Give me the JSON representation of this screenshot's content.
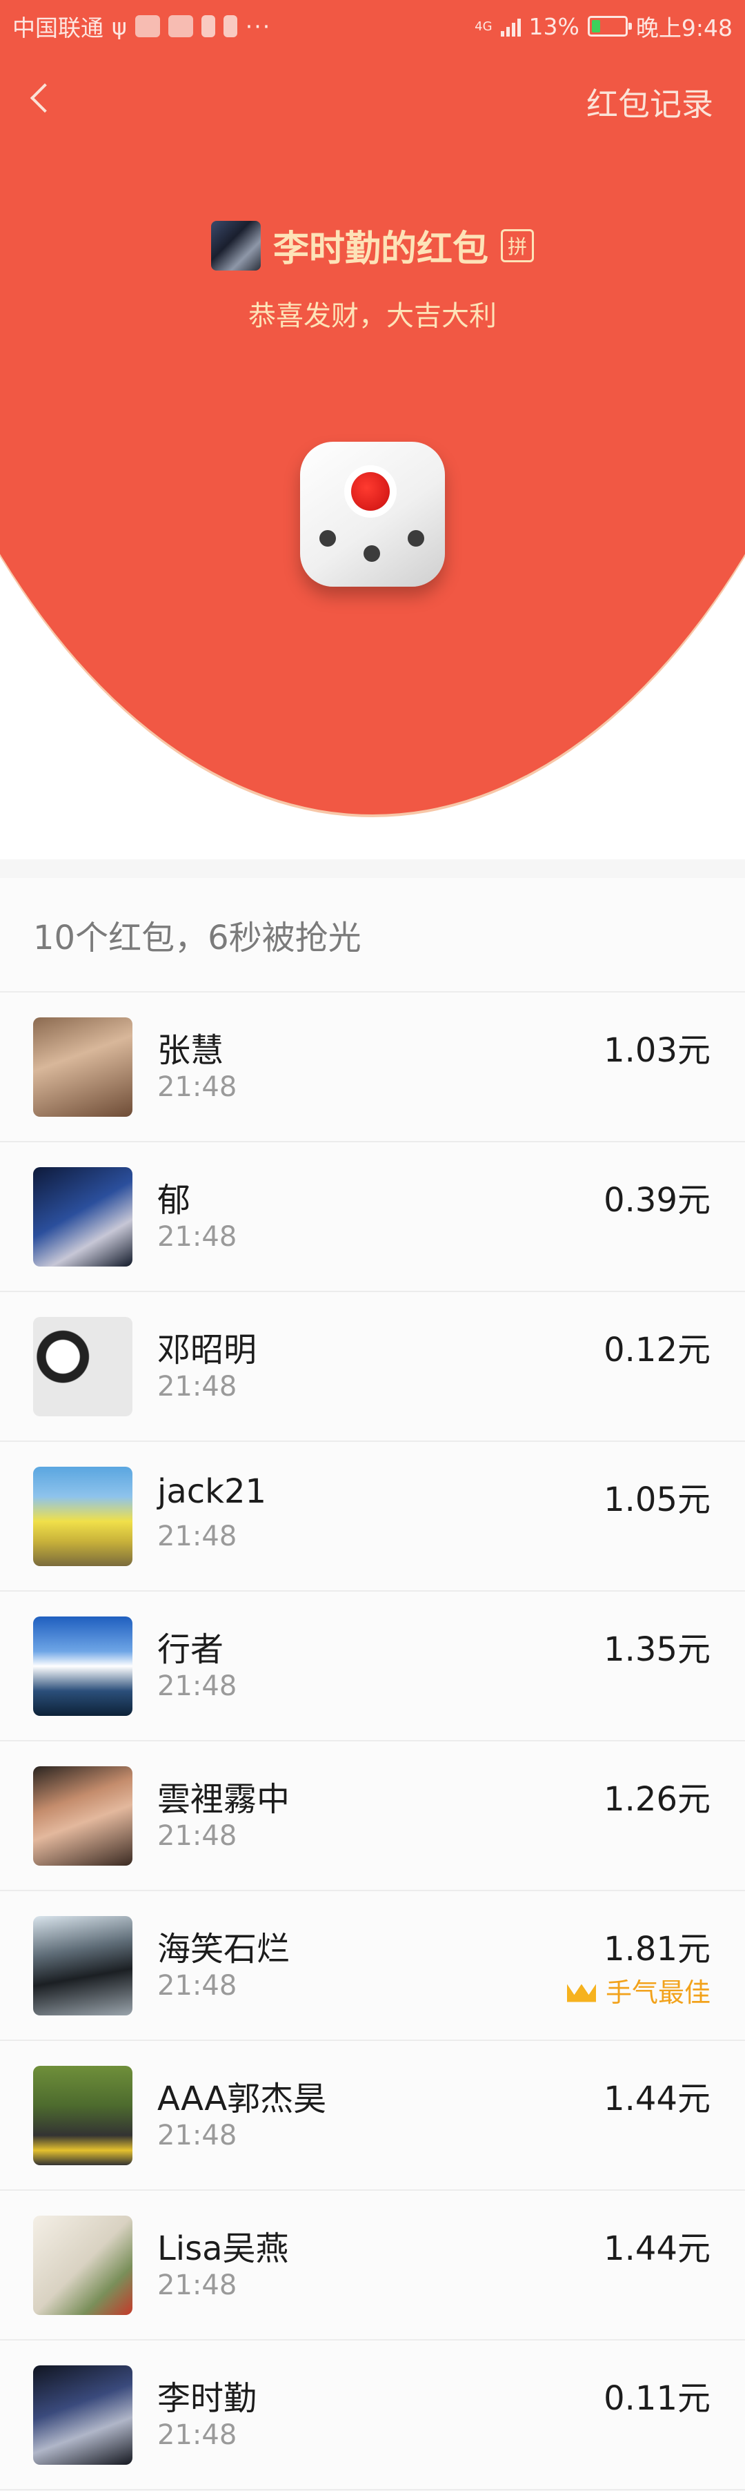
{
  "status_bar": {
    "carrier": "中国联通",
    "usb_glyph": "ψ",
    "more_dots": "···",
    "network": "4G",
    "battery_percent": "13%",
    "time": "晚上9:48"
  },
  "header": {
    "back_icon": "chevron-left-icon",
    "record_link": "红包记录",
    "sender_title": "李时勤的红包",
    "pin_badge": "拼",
    "blessing": "恭喜发财，大吉大利"
  },
  "colors": {
    "red": "#f15844",
    "gold_text": "#fde3b8",
    "best_luck": "#f2a21b"
  },
  "summary": "10个红包，6秒被抢光",
  "recipients": [
    {
      "name": "张慧",
      "time": "21:48",
      "amount": "1.03元",
      "avatar": "g1"
    },
    {
      "name": "郁",
      "time": "21:48",
      "amount": "0.39元",
      "avatar": "g2"
    },
    {
      "name": "邓昭明",
      "time": "21:48",
      "amount": "0.12元",
      "avatar": "g3"
    },
    {
      "name": "jack21",
      "time": "21:48",
      "amount": "1.05元",
      "avatar": "g4"
    },
    {
      "name": "行者",
      "time": "21:48",
      "amount": "1.35元",
      "avatar": "g5"
    },
    {
      "name": "雲裡霧中",
      "time": "21:48",
      "amount": "1.26元",
      "avatar": "g6"
    },
    {
      "name": "海笑石烂",
      "time": "21:48",
      "amount": "1.81元",
      "avatar": "g7",
      "best_label": "手气最佳"
    },
    {
      "name": "AAA郭杰昊",
      "time": "21:48",
      "amount": "1.44元",
      "avatar": "g8"
    },
    {
      "name": "Lisa吴燕",
      "time": "21:48",
      "amount": "1.44元",
      "avatar": "g9"
    },
    {
      "name": "李时勤",
      "time": "21:48",
      "amount": "0.11元",
      "avatar": "g10"
    }
  ]
}
